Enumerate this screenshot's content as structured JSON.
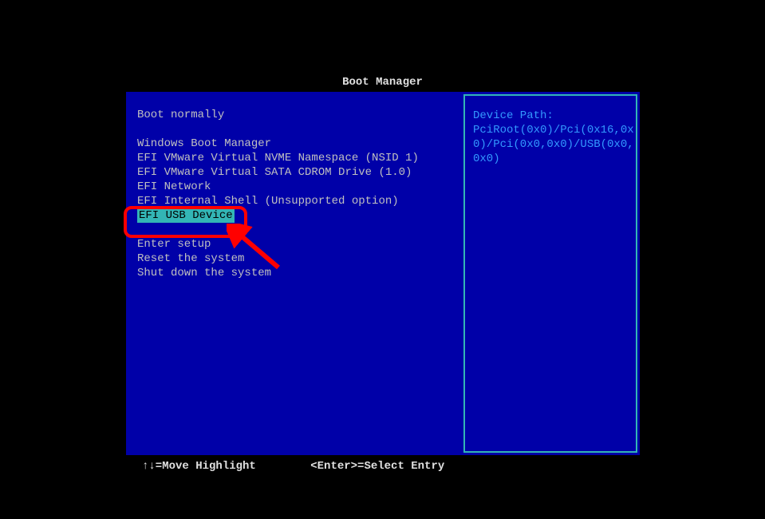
{
  "title": "Boot Manager",
  "left_menu": {
    "boot_normally": "Boot normally",
    "items": [
      "Windows Boot Manager",
      "EFI VMware Virtual NVME Namespace (NSID 1)",
      "EFI VMware Virtual SATA CDROM Drive (1.0)",
      "EFI Network",
      "EFI Internal Shell (Unsupported option)"
    ],
    "selected": "EFI USB Device",
    "bottom": [
      "Enter setup",
      "Reset the system",
      "Shut down the system"
    ]
  },
  "right_panel": {
    "header": "Device Path:",
    "lines": [
      "PciRoot(0x0)/Pci(0x16,0x",
      "0)/Pci(0x0,0x0)/USB(0x0,",
      "0x0)"
    ]
  },
  "footer": {
    "move": "↑↓=Move Highlight",
    "select": "<Enter>=Select Entry"
  }
}
